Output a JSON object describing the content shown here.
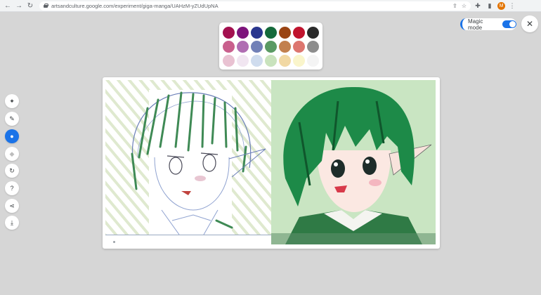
{
  "browser": {
    "url": "artsandculture.google.com/experiment/giga-manga/UAHzM-yZUdUpNA",
    "profile_initial": "M",
    "icons": [
      "back-icon",
      "forward-icon",
      "reload-icon",
      "lock-icon",
      "share-icon",
      "star-icon",
      "extensions-icon",
      "sidepanel-icon",
      "menu-icon"
    ]
  },
  "palette": {
    "colors": [
      "#a3104f",
      "#7d147b",
      "#2a368e",
      "#156a3b",
      "#9a4413",
      "#c0142e",
      "#2a2a2a",
      "#c95f8d",
      "#b06db2",
      "#7180b7",
      "#5a9a63",
      "#c2804e",
      "#dd766f",
      "#8d8d8d",
      "#e9c2d2",
      "#f1e6f1",
      "#cfdcee",
      "#c9e3bd",
      "#f1d8a3",
      "#faf5cb",
      "#f4f4f4"
    ]
  },
  "magic_mode": {
    "label": "Magic mode",
    "enabled": true
  },
  "toolbar": {
    "tools": [
      {
        "name": "magic-wand-tool",
        "icon": "magic-wand-icon",
        "active": false,
        "disabled": false
      },
      {
        "name": "pencil-tool",
        "icon": "pencil-icon",
        "active": false,
        "disabled": false
      },
      {
        "name": "palette-tool",
        "icon": "palette-icon",
        "active": true,
        "disabled": false
      },
      {
        "name": "eraser-tool",
        "icon": "eraser-icon",
        "active": false,
        "disabled": true
      },
      {
        "name": "reset-tool",
        "icon": "refresh-icon",
        "active": false,
        "disabled": false
      },
      {
        "name": "help-tool",
        "icon": "help-icon",
        "active": false,
        "disabled": false
      },
      {
        "name": "share-tool",
        "icon": "share-icon",
        "active": false,
        "disabled": false
      },
      {
        "name": "download-tool",
        "icon": "download-icon",
        "active": false,
        "disabled": false
      }
    ]
  },
  "glyphs": {
    "back": "←",
    "forward": "→",
    "reload": "↻",
    "share": "⇪",
    "star": "☆",
    "extensions": "✚",
    "sidepanel": "▮",
    "menu": "⋮",
    "close": "✕",
    "magic-wand-icon": "✦",
    "pencil-icon": "✎",
    "palette-icon": "●",
    "eraser-icon": "◆",
    "refresh-icon": "↻",
    "help-icon": "?",
    "share-icon": "⋖",
    "download-icon": "⤓"
  },
  "colors": {
    "accent": "#1a73e8",
    "background": "#d6d6d6",
    "render_green": "#1d8a48"
  }
}
